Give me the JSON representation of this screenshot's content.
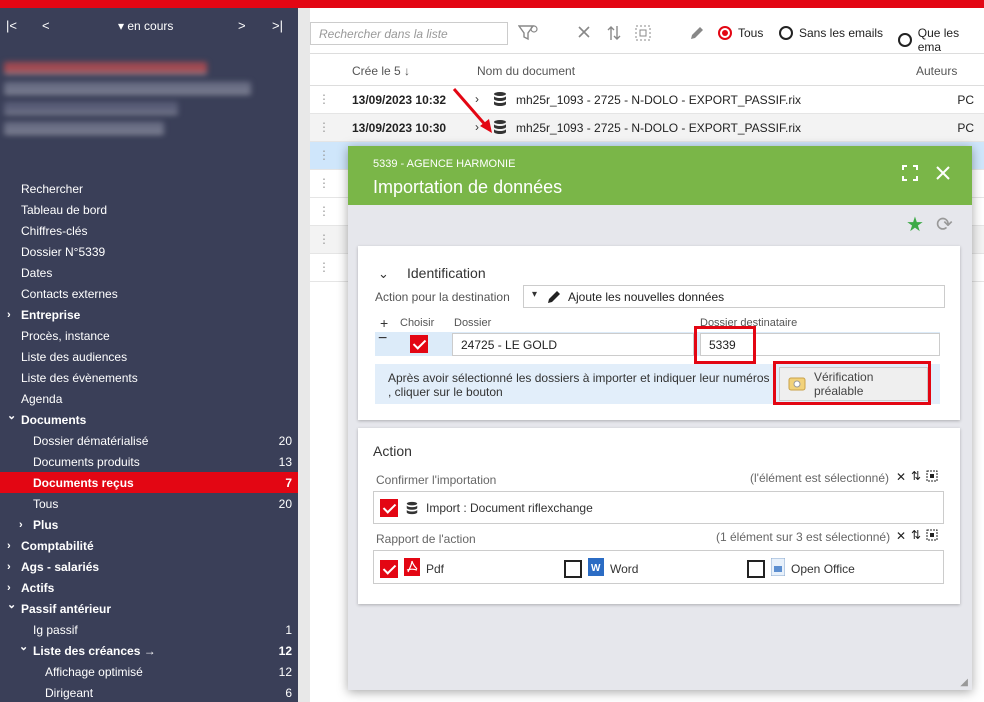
{
  "sidebar": {
    "nav": {
      "first": "|<",
      "prev": "<",
      "state": "▾ en cours",
      "next": ">",
      "last": ">|"
    },
    "menu": [
      {
        "label": "Rechercher",
        "count": "",
        "indent": 0,
        "bold": false
      },
      {
        "label": "Tableau de bord",
        "count": "",
        "indent": 0,
        "bold": false
      },
      {
        "label": "Chiffres-clés",
        "count": "",
        "indent": 0,
        "bold": false
      },
      {
        "label": "Dossier N°5339",
        "count": "",
        "indent": 0,
        "bold": false
      },
      {
        "label": "Dates",
        "count": "",
        "indent": 0,
        "bold": false
      },
      {
        "label": "Contacts externes",
        "count": "",
        "indent": 0,
        "bold": false
      },
      {
        "label": "Entreprise",
        "count": "",
        "indent": 0,
        "bold": true,
        "chev": ">"
      },
      {
        "label": "Procès, instance",
        "count": "",
        "indent": 0,
        "bold": false
      },
      {
        "label": "Liste des audiences",
        "count": "",
        "indent": 0,
        "bold": false
      },
      {
        "label": "Liste des évènements",
        "count": "",
        "indent": 0,
        "bold": false
      },
      {
        "label": "Agenda",
        "count": "",
        "indent": 0,
        "bold": false
      },
      {
        "label": "Documents",
        "count": "",
        "indent": 0,
        "bold": true,
        "chev": "v"
      },
      {
        "label": "Dossier dématérialisé",
        "count": "20",
        "indent": 1,
        "bold": false
      },
      {
        "label": "Documents produits",
        "count": "13",
        "indent": 1,
        "bold": false
      },
      {
        "label": "Documents reçus",
        "count": "7",
        "indent": 1,
        "bold": true,
        "active": true
      },
      {
        "label": "Tous",
        "count": "20",
        "indent": 1,
        "bold": false
      },
      {
        "label": "Plus",
        "count": "",
        "indent": 1,
        "bold": true,
        "chev": ">"
      },
      {
        "label": "Comptabilité",
        "count": "",
        "indent": 0,
        "bold": true,
        "chev": ">"
      },
      {
        "label": "Ags - salariés",
        "count": "",
        "indent": 0,
        "bold": true,
        "chev": ">"
      },
      {
        "label": "Actifs",
        "count": "",
        "indent": 0,
        "bold": true,
        "chev": ">"
      },
      {
        "label": "Passif antérieur",
        "count": "",
        "indent": 0,
        "bold": true,
        "chev": "v"
      },
      {
        "label": "Ig passif",
        "count": "1",
        "indent": 1,
        "bold": false
      },
      {
        "label": "Liste des créances →",
        "count": "12",
        "indent": 1,
        "bold": true,
        "chev": "v"
      },
      {
        "label": "Affichage optimisé",
        "count": "12",
        "indent": 2,
        "bold": false
      },
      {
        "label": "Dirigeant",
        "count": "6",
        "indent": 2,
        "bold": false
      }
    ]
  },
  "toolbar": {
    "search_placeholder": "Rechercher dans la liste",
    "radio_all": "Tous",
    "radio_no_email": "Sans les emails",
    "radio_only_email": "Que les ema"
  },
  "table": {
    "col_date": "Crée le 5 ↓",
    "col_name": "Nom du document",
    "col_author": "Auteurs",
    "rows": [
      {
        "date": "13/09/2023 10:32",
        "name": "mh25r_1093 - 2725 - N-DOLO - EXPORT_PASSIF.rix",
        "author": "PC"
      },
      {
        "date": "13/09/2023 10:30",
        "name": "mh25r_1093 - 2725 - N-DOLO - EXPORT_PASSIF.rix",
        "author": "PC"
      }
    ]
  },
  "dialog": {
    "subtitle": "5339 - AGENCE HARMONIE",
    "title": "Importation de données",
    "identification": {
      "title": "Identification",
      "action_label": "Action pour la destination",
      "action_value": "Ajoute les nouvelles données",
      "col_choose": "Choisir",
      "col_dossier": "Dossier",
      "col_dest": "Dossier destinataire",
      "dossier_value": "24725 - LE GOLD",
      "dest_value": "5339",
      "info_text_1": "Après avoir sélectionné les dossiers à importer et indiquer leur numéros",
      "info_text_2": ", cliquer sur le bouton",
      "verif_button": "Vérification préalable"
    },
    "action": {
      "title": "Action",
      "confirm_label": "Confirmer l'importation",
      "confirm_status": "(l'élément est sélectionné)",
      "import_item": "Import : Document riflexchange",
      "report_label": "Rapport de l'action",
      "report_status": "(1 élément sur 3 est sélectionné)",
      "opt_pdf": "Pdf",
      "opt_word": "Word",
      "opt_oo": "Open Office"
    }
  }
}
